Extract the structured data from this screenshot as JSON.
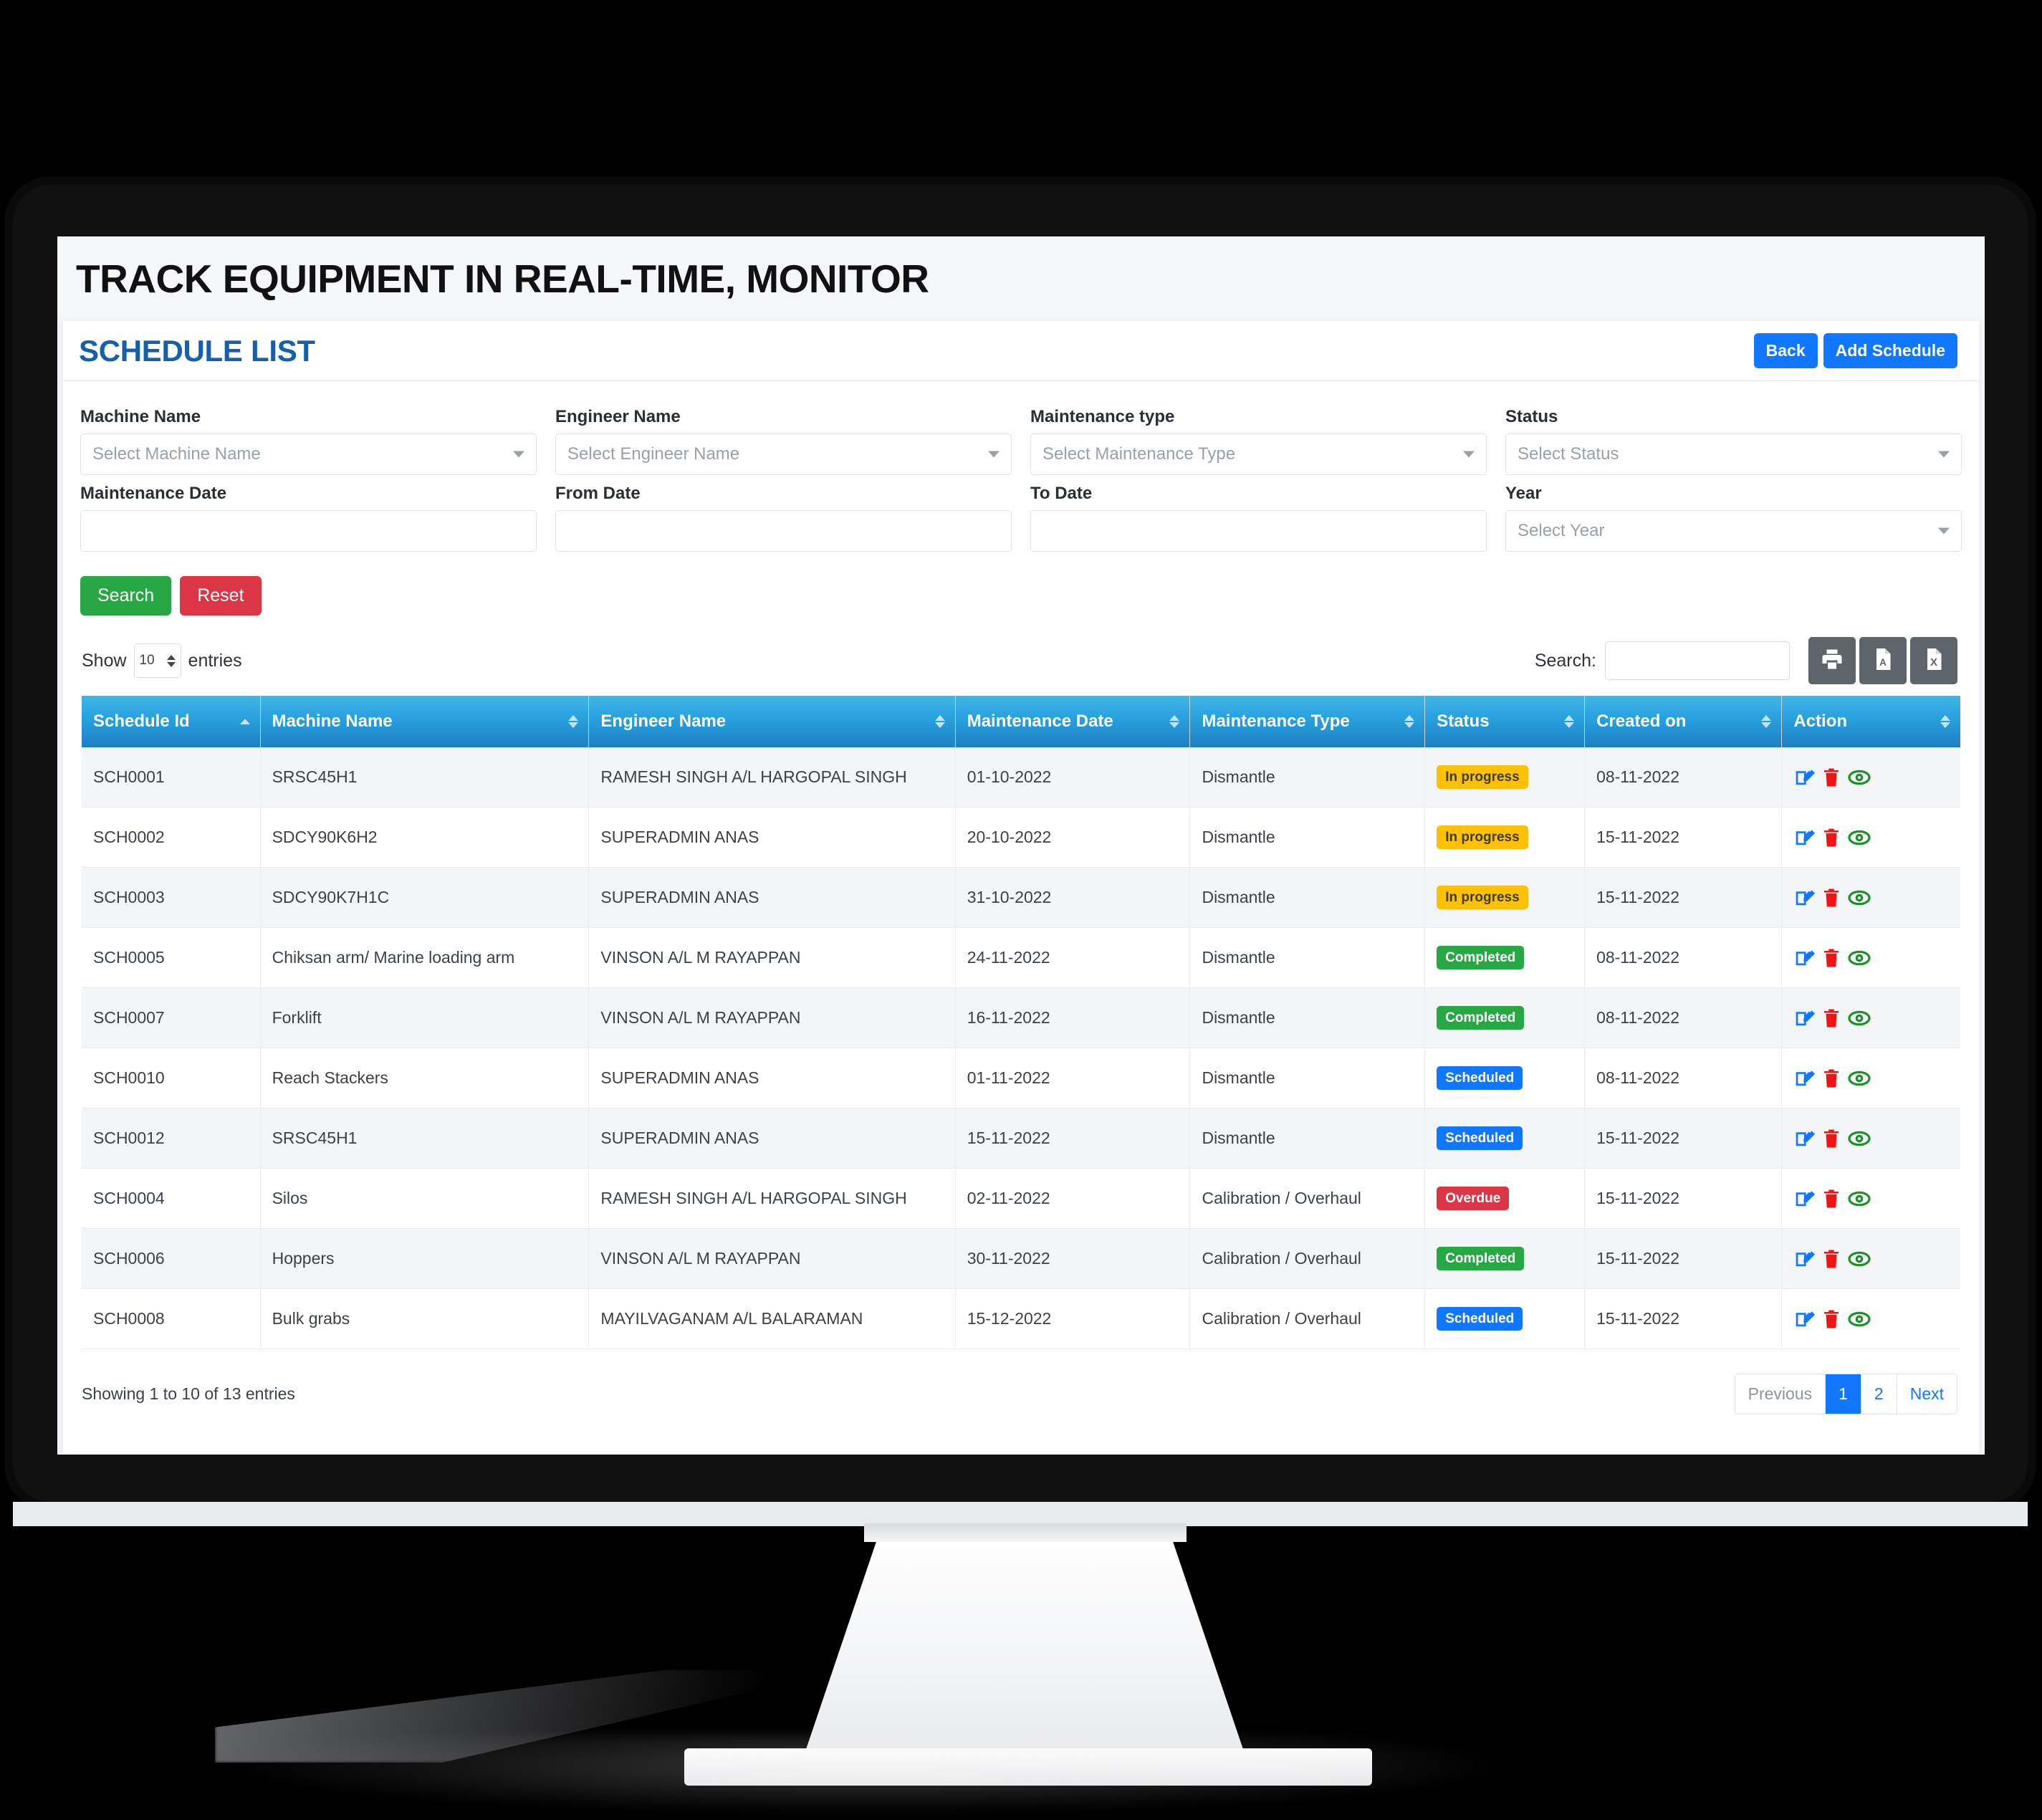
{
  "page": {
    "title": "TRACK EQUIPMENT IN REAL-TIME, MONITOR"
  },
  "card": {
    "title": "SCHEDULE LIST",
    "back_label": "Back",
    "add_label": "Add Schedule"
  },
  "filters": {
    "machine_name": {
      "label": "Machine Name",
      "placeholder": "Select Machine Name",
      "value": ""
    },
    "engineer_name": {
      "label": "Engineer Name",
      "placeholder": "Select Engineer Name",
      "value": ""
    },
    "maintenance_type": {
      "label": "Maintenance type",
      "placeholder": "Select Maintenance Type",
      "value": ""
    },
    "status": {
      "label": "Status",
      "placeholder": "Select Status",
      "value": ""
    },
    "maintenance_date": {
      "label": "Maintenance Date",
      "value": ""
    },
    "from_date": {
      "label": "From Date",
      "value": ""
    },
    "to_date": {
      "label": "To Date",
      "value": ""
    },
    "year": {
      "label": "Year",
      "placeholder": "Select Year",
      "value": ""
    },
    "search_label": "Search",
    "reset_label": "Reset"
  },
  "datatable": {
    "show_label": "Show",
    "entries_label": "entries",
    "page_length": "10",
    "search_label": "Search:",
    "search_value": "",
    "export": {
      "print": "print-icon",
      "pdf": "pdf-icon",
      "excel": "excel-icon"
    },
    "columns": [
      "Schedule Id",
      "Machine Name",
      "Engineer Name",
      "Maintenance Date",
      "Maintenance Type",
      "Status",
      "Created on",
      "Action"
    ],
    "rows": [
      {
        "schedule_id": "SCH0001",
        "machine_name": "SRSC45H1",
        "engineer_name": "RAMESH SINGH A/L HARGOPAL SINGH",
        "maintenance_date": "01-10-2022",
        "maintenance_type": "Dismantle",
        "status": "In progress",
        "status_kind": "inprogress",
        "created_on": "08-11-2022"
      },
      {
        "schedule_id": "SCH0002",
        "machine_name": "SDCY90K6H2",
        "engineer_name": "SUPERADMIN ANAS",
        "maintenance_date": "20-10-2022",
        "maintenance_type": "Dismantle",
        "status": "In progress",
        "status_kind": "inprogress",
        "created_on": "15-11-2022"
      },
      {
        "schedule_id": "SCH0003",
        "machine_name": "SDCY90K7H1C",
        "engineer_name": "SUPERADMIN ANAS",
        "maintenance_date": "31-10-2022",
        "maintenance_type": "Dismantle",
        "status": "In progress",
        "status_kind": "inprogress",
        "created_on": "15-11-2022"
      },
      {
        "schedule_id": "SCH0005",
        "machine_name": "Chiksan arm/ Marine loading arm",
        "engineer_name": "VINSON A/L M RAYAPPAN",
        "maintenance_date": "24-11-2022",
        "maintenance_type": "Dismantle",
        "status": "Completed",
        "status_kind": "completed",
        "created_on": "08-11-2022"
      },
      {
        "schedule_id": "SCH0007",
        "machine_name": "Forklift",
        "engineer_name": "VINSON A/L M RAYAPPAN",
        "maintenance_date": "16-11-2022",
        "maintenance_type": "Dismantle",
        "status": "Completed",
        "status_kind": "completed",
        "created_on": "08-11-2022"
      },
      {
        "schedule_id": "SCH0010",
        "machine_name": "Reach Stackers",
        "engineer_name": "SUPERADMIN ANAS",
        "maintenance_date": "01-11-2022",
        "maintenance_type": "Dismantle",
        "status": "Scheduled",
        "status_kind": "scheduled",
        "created_on": "08-11-2022"
      },
      {
        "schedule_id": "SCH0012",
        "machine_name": "SRSC45H1",
        "engineer_name": "SUPERADMIN ANAS",
        "maintenance_date": "15-11-2022",
        "maintenance_type": "Dismantle",
        "status": "Scheduled",
        "status_kind": "scheduled",
        "created_on": "15-11-2022"
      },
      {
        "schedule_id": "SCH0004",
        "machine_name": "Silos",
        "engineer_name": "RAMESH SINGH A/L HARGOPAL SINGH",
        "maintenance_date": "02-11-2022",
        "maintenance_type": "Calibration / Overhaul",
        "status": "Overdue",
        "status_kind": "overdue",
        "created_on": "15-11-2022"
      },
      {
        "schedule_id": "SCH0006",
        "machine_name": "Hoppers",
        "engineer_name": "VINSON A/L M RAYAPPAN",
        "maintenance_date": "30-11-2022",
        "maintenance_type": "Calibration / Overhaul",
        "status": "Completed",
        "status_kind": "completed",
        "created_on": "15-11-2022"
      },
      {
        "schedule_id": "SCH0008",
        "machine_name": "Bulk grabs",
        "engineer_name": "MAYILVAGANAM A/L BALARAMAN",
        "maintenance_date": "15-12-2022",
        "maintenance_type": "Calibration / Overhaul",
        "status": "Scheduled",
        "status_kind": "scheduled",
        "created_on": "15-11-2022"
      }
    ],
    "info": "Showing 1 to 10 of 13 entries",
    "pagination": {
      "previous": "Previous",
      "pages": [
        "1",
        "2"
      ],
      "active": "1",
      "next": "Next"
    }
  },
  "colors": {
    "accent_blue": "#1177ff",
    "title_blue": "#1560ad",
    "header_gradient_top": "#41b6e6",
    "header_gradient_bottom": "#1d7fc4",
    "success": "#28a745",
    "danger": "#dc3545",
    "warning": "#ffc107",
    "export_btn": "#5e6469"
  }
}
